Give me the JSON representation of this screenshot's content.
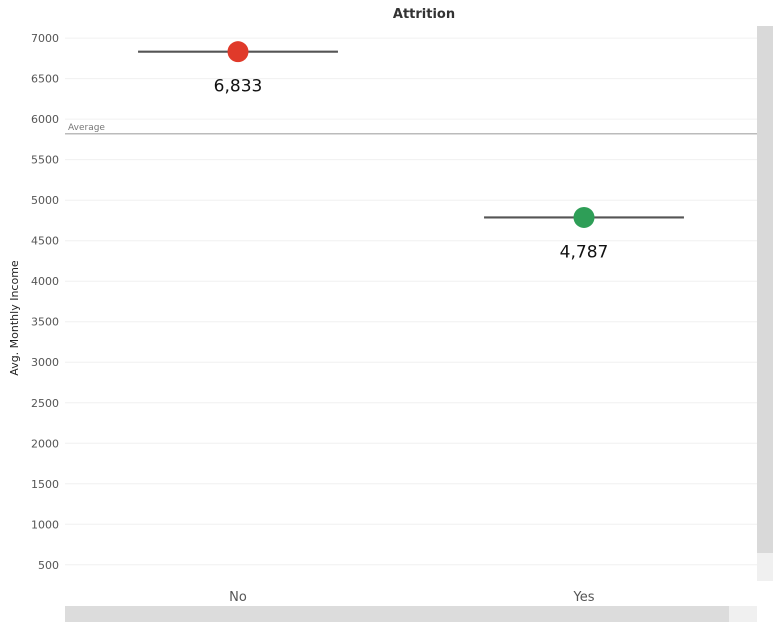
{
  "chart_data": {
    "type": "scatter",
    "title": "Attrition",
    "xlabel": "",
    "ylabel": "Avg. Monthly Income",
    "categories": [
      "No",
      "Yes"
    ],
    "values": [
      6833,
      4787
    ],
    "data_labels": [
      "6,833",
      "4,787"
    ],
    "ylim": [
      300,
      7150
    ],
    "yticks": [
      "500",
      "1000",
      "1500",
      "2000",
      "2500",
      "3000",
      "3500",
      "4000",
      "4500",
      "5000",
      "5500",
      "6000",
      "6500",
      "7000"
    ],
    "ytick_values": [
      500,
      1000,
      1500,
      2000,
      2500,
      3000,
      3500,
      4000,
      4500,
      5000,
      5500,
      6000,
      6500,
      7000
    ],
    "reference_line": {
      "label": "Average",
      "value": 5820
    },
    "grid": true,
    "colors": {
      "No": "#e03a2a",
      "Yes": "#2e9e57",
      "line": "#555555",
      "reference": "#bbbbbb",
      "grid": "#f0f0f0"
    }
  }
}
